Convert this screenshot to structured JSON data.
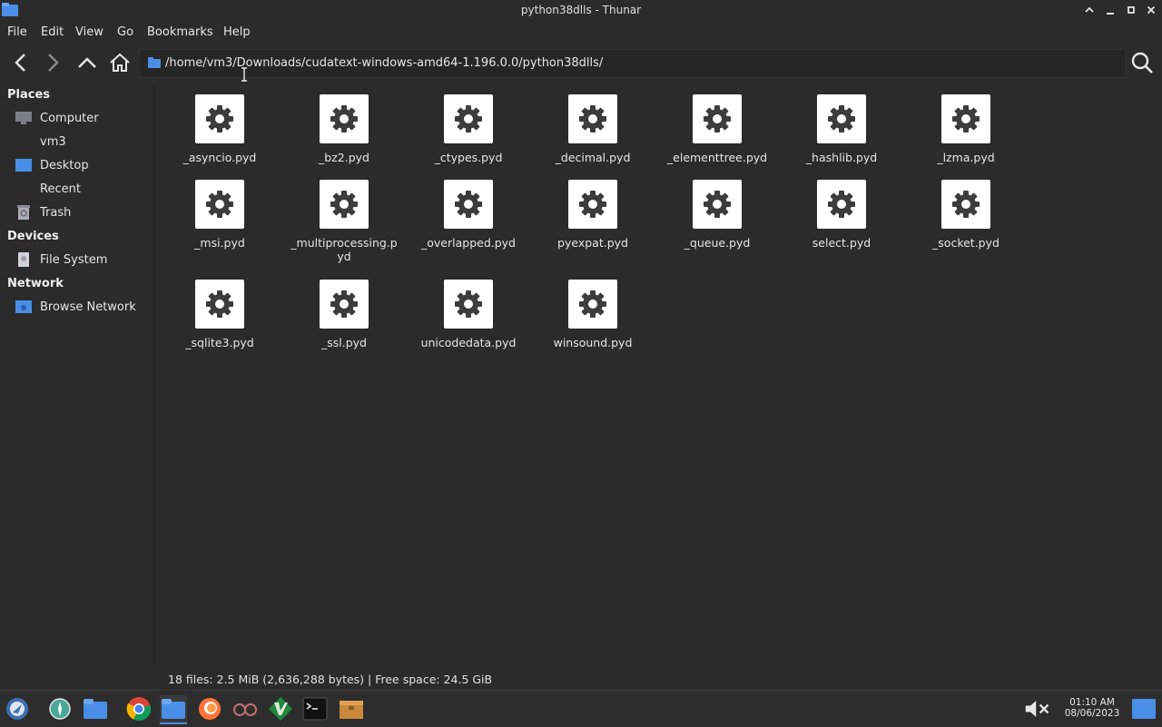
{
  "window": {
    "title": "python38dlls - Thunar"
  },
  "menu": [
    "File",
    "Edit",
    "View",
    "Go",
    "Bookmarks",
    "Help"
  ],
  "location": {
    "path": "/home/vm3/Downloads/cudatext-windows-amd64-1.196.0.0/python38dlls/"
  },
  "sidebar": {
    "places_header": "Places",
    "places": [
      "Computer",
      "vm3",
      "Desktop",
      "Recent",
      "Trash"
    ],
    "devices_header": "Devices",
    "devices": [
      "File System"
    ],
    "network_header": "Network",
    "network": [
      "Browse Network"
    ]
  },
  "files": [
    "_asyncio.pyd",
    "_bz2.pyd",
    "_ctypes.pyd",
    "_decimal.pyd",
    "_elementtree.pyd",
    "_hashlib.pyd",
    "_lzma.pyd",
    "_msi.pyd",
    "_multiprocessing.pyd",
    "_overlapped.pyd",
    "pyexpat.pyd",
    "_queue.pyd",
    "select.pyd",
    "_socket.pyd",
    "_sqlite3.pyd",
    "_ssl.pyd",
    "unicodedata.pyd",
    "winsound.pyd"
  ],
  "status": "18 files: 2.5 MiB (2,636,288 bytes)  |  Free space: 24.5 GiB",
  "clock": {
    "time": "01:10 AM",
    "date": "08/06/2023"
  },
  "colors": {
    "background": "#2b2b2b",
    "folder_blue": "#4a8fe7",
    "icon_gray": "#3c3c3c"
  }
}
